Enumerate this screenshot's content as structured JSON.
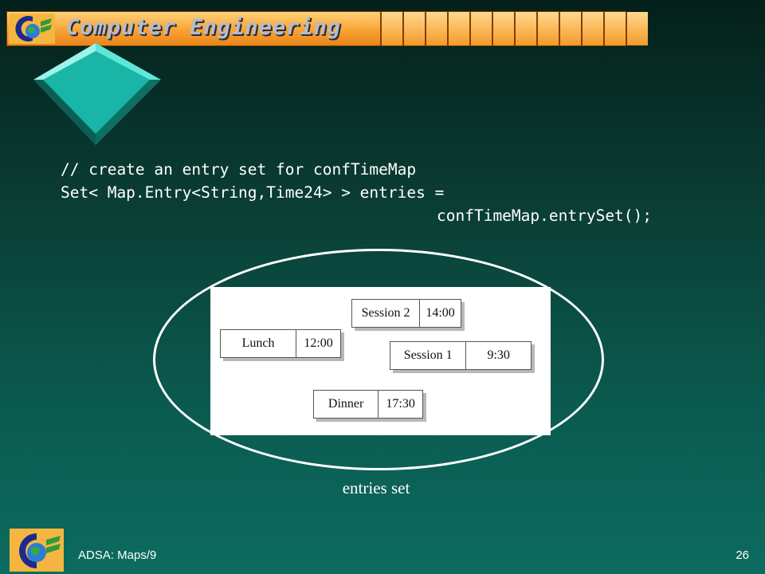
{
  "header": {
    "title": "Computer Engineering"
  },
  "code": {
    "line1": "// create an entry set for confTimeMap",
    "line2": "Set< Map.Entry<String,Time24> > entries =",
    "line3": "confTimeMap.entrySet();"
  },
  "figure": {
    "entries": [
      {
        "key": "Session 2",
        "value": "14:00"
      },
      {
        "key": "Lunch",
        "value": "12:00"
      },
      {
        "key": "Session 1",
        "value": "9:30"
      },
      {
        "key": "Dinner",
        "value": "17:30"
      }
    ],
    "caption": "entries set"
  },
  "footer": {
    "left": "ADSA: Maps/9",
    "page": "26"
  },
  "colors": {
    "banner": "#f7a233",
    "accent_diamond": "#1fc0b0",
    "background": "#0b5a4f"
  },
  "icons": {
    "logo": "globe-c-logo-icon",
    "decoration": "diamond-icon"
  }
}
